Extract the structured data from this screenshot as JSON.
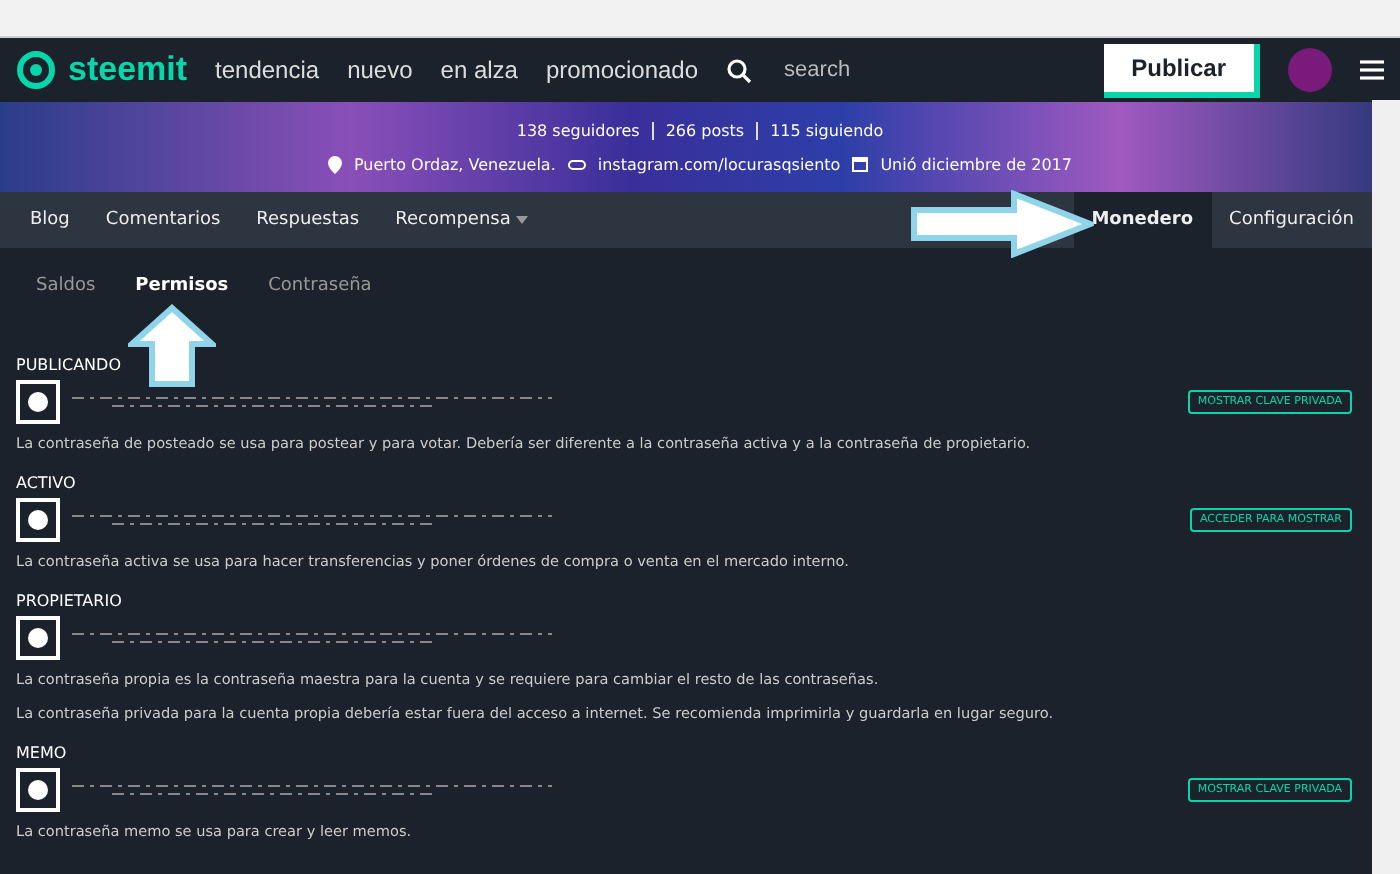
{
  "header": {
    "brand": "steemit",
    "nav": [
      "tendencia",
      "nuevo",
      "en alza",
      "promocionado"
    ],
    "search_placeholder": "search",
    "publish": "Publicar"
  },
  "profile": {
    "stats": [
      "138 seguidores",
      "266 posts",
      "115 siguiendo"
    ],
    "location": "Puerto Ordaz, Venezuela.",
    "website": "instagram.com/locurasqsiento",
    "joined": "Unió diciembre de 2017"
  },
  "tabs": [
    {
      "label": "Blog",
      "selected": false,
      "dropdown": false
    },
    {
      "label": "Comentarios",
      "selected": false,
      "dropdown": false
    },
    {
      "label": "Respuestas",
      "selected": false,
      "dropdown": false
    },
    {
      "label": "Recompensa",
      "selected": false,
      "dropdown": true
    }
  ],
  "right_tabs": [
    {
      "label": "Monedero",
      "selected": true
    },
    {
      "label": "Configuración",
      "selected": false
    }
  ],
  "subtabs": [
    {
      "label": "Saldos",
      "selected": false
    },
    {
      "label": "Permisos",
      "selected": true
    },
    {
      "label": "Contraseña",
      "selected": false
    }
  ],
  "keys": [
    {
      "label": "PUBLICANDO",
      "button": "MOSTRAR CLAVE PRIVADA",
      "descriptions": [
        "La contraseña de posteado se usa para postear y para votar. Debería ser diferente a la contraseña activa y a la contraseña de propietario."
      ]
    },
    {
      "label": "ACTIVO",
      "button": "ACCEDER PARA MOSTRAR",
      "descriptions": [
        "La contraseña activa se usa para hacer transferencias y poner órdenes de compra o venta en el mercado interno."
      ]
    },
    {
      "label": "PROPIETARIO",
      "descriptions": [
        "La contraseña propia es la contraseña maestra para la cuenta y se requiere para cambiar el resto de las contraseñas.",
        "La contraseña privada para la cuenta propia debería estar fuera del acceso a internet. Se recomienda imprimirla y guardarla en lugar seguro."
      ]
    },
    {
      "label": "MEMO",
      "button": "MOSTRAR CLAVE PRIVADA",
      "descriptions": [
        "La contraseña memo se usa para crear y leer memos."
      ]
    }
  ]
}
